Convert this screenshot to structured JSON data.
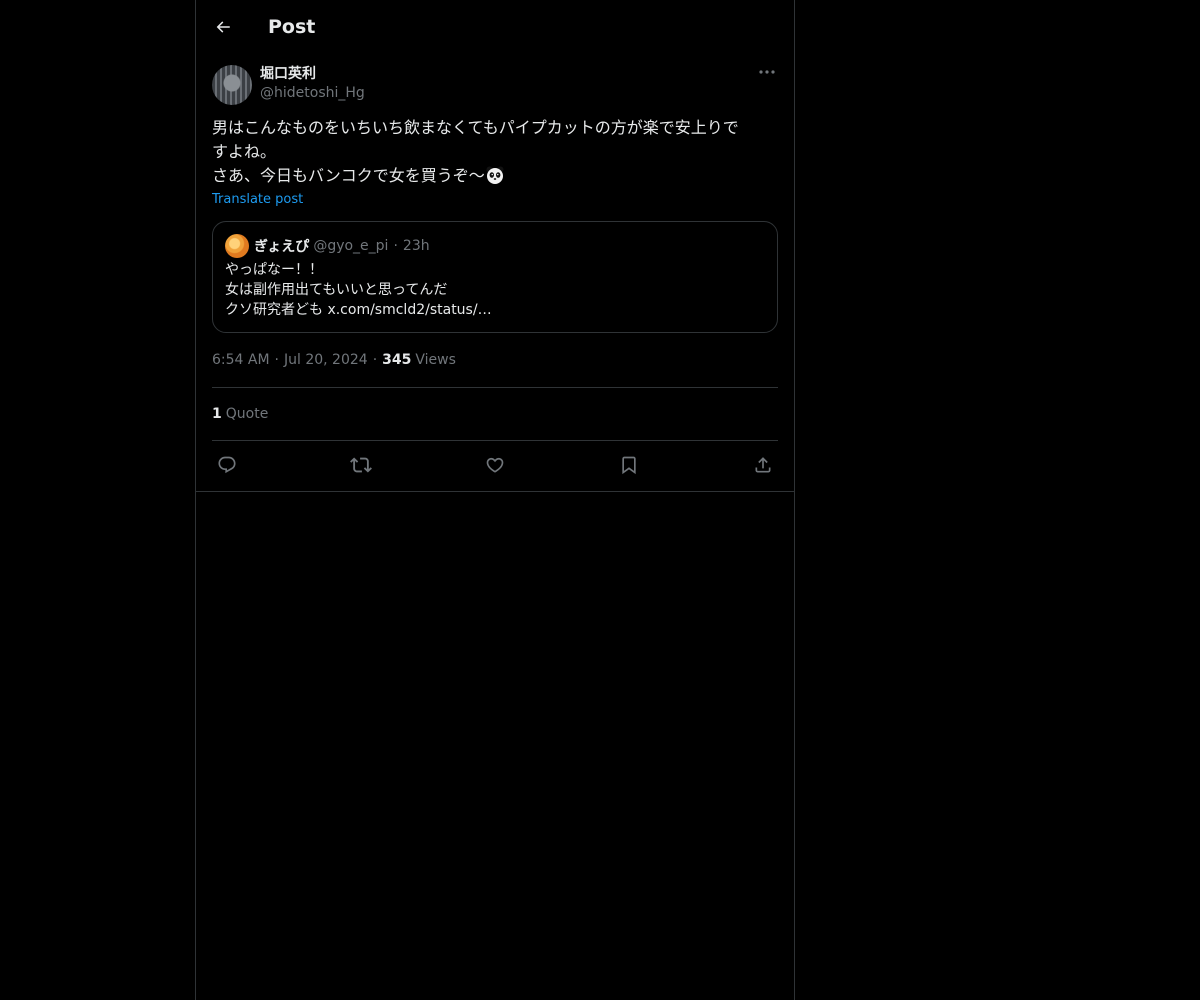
{
  "header": {
    "title": "Post",
    "back_icon": "arrow-left-icon"
  },
  "post": {
    "author": {
      "name": "堀口英利",
      "handle": "@hidetoshi_Hg"
    },
    "more_icon": "more-horizontal-icon",
    "text_line1": "男はこんなものをいちいち飲まなくてもパイプカットの方が楽で安上りで",
    "text_line2": "すよね。",
    "text_line3": "さあ、今日もバンコクで女を買うぞ〜",
    "emoji": "panda-emoji",
    "translate_label": "Translate post",
    "quote": {
      "name": "ぎょえぴ",
      "handle": "@gyo_e_pi",
      "separator": "·",
      "time": "23h",
      "line1": "やっぱなー！！",
      "line2": "女は副作用出てもいいと思ってんだ",
      "line3": "クソ研究者ども x.com/smcld2/status/…"
    },
    "meta": {
      "time": "6:54 AM",
      "separator": "·",
      "date": "Jul 20, 2024",
      "views_count": "345",
      "views_label": "Views"
    },
    "stats": {
      "quotes_count": "1",
      "quotes_label": "Quote"
    },
    "actions": [
      {
        "icon": "reply-icon"
      },
      {
        "icon": "repost-icon"
      },
      {
        "icon": "like-icon"
      },
      {
        "icon": "bookmark-icon"
      },
      {
        "icon": "share-icon"
      }
    ]
  },
  "colors": {
    "background": "#000000",
    "text": "#e7e9ea",
    "secondary_text": "#71767b",
    "link": "#1d9bf0",
    "border": "#2f3336"
  }
}
